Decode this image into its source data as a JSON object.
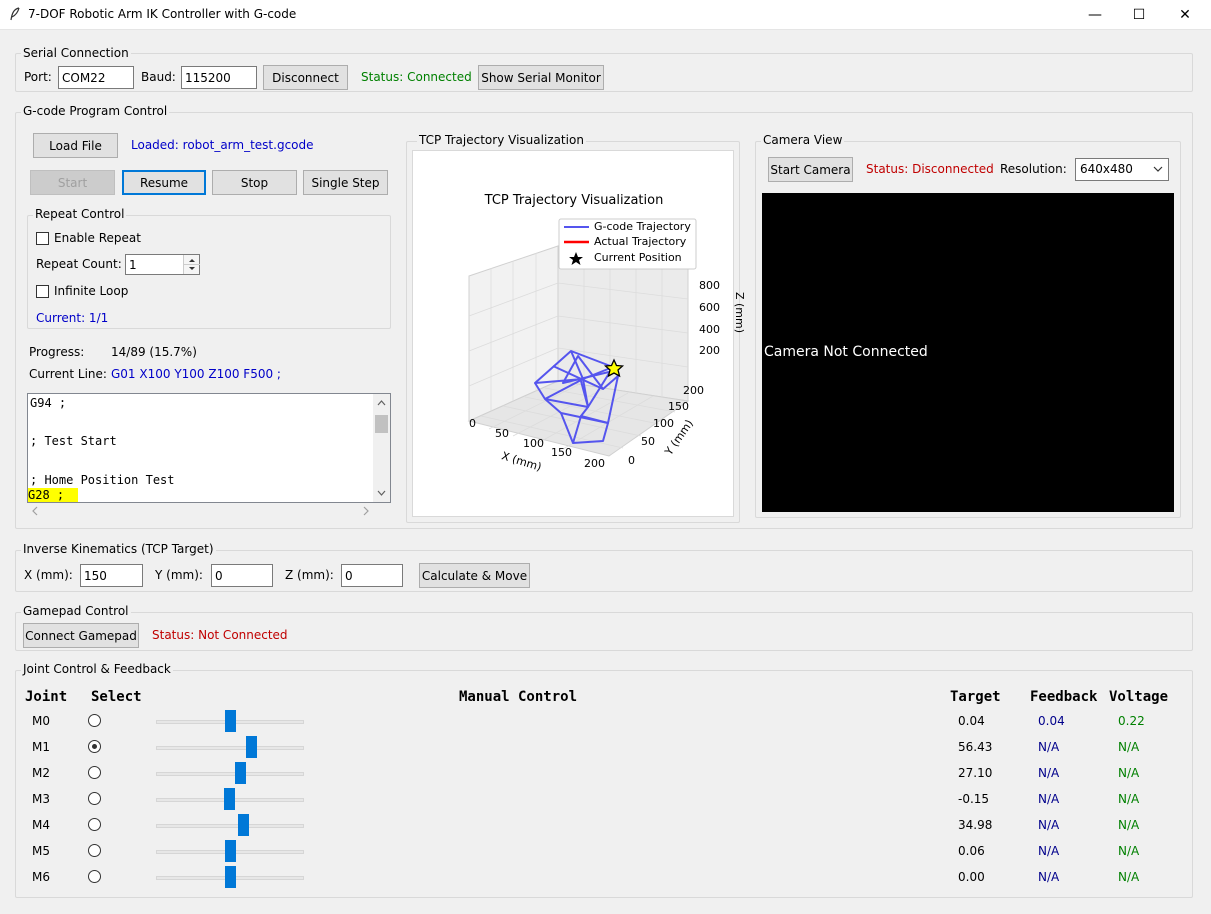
{
  "window": {
    "title": "7-DOF Robotic Arm IK Controller with G-code",
    "minimize": "—",
    "maximize": "☐",
    "close": "✕"
  },
  "serial": {
    "group_label": "Serial Connection",
    "port_label": "Port:",
    "port_value": "COM22",
    "baud_label": "Baud:",
    "baud_value": "115200",
    "disconnect_label": "Disconnect",
    "status": "Status: Connected",
    "monitor_label": "Show Serial Monitor"
  },
  "gcode": {
    "group_label": "G-code Program Control",
    "load_label": "Load File",
    "loaded_text": "Loaded: robot_arm_test.gcode",
    "start_label": "Start",
    "resume_label": "Resume",
    "stop_label": "Stop",
    "step_label": "Single Step",
    "repeat": {
      "group_label": "Repeat Control",
      "enable_label": "Enable Repeat",
      "count_label": "Repeat Count:",
      "count_value": "1",
      "infinite_label": "Infinite Loop",
      "current": "Current: 1/1"
    },
    "progress_label": "Progress:",
    "progress_value": "14/89 (15.7%)",
    "current_line_label": "Current Line:",
    "current_line_value": "G01 X100 Y100 Z100 F500 ;",
    "lines": [
      "G94 ;",
      "",
      "; Test Start",
      "",
      "; Home Position Test",
      "G28 ;"
    ]
  },
  "trajectory": {
    "group_label": "TCP Trajectory Visualization",
    "plot_title": "TCP Trajectory Visualization",
    "legend": [
      "G-code Trajectory",
      "Actual Trajectory",
      "Current Position"
    ],
    "x_label": "X (mm)",
    "y_label": "Y (mm)",
    "z_label": "Z (mm)",
    "x_ticks": [
      "0",
      "50",
      "100",
      "150",
      "200"
    ],
    "y_ticks": [
      "0",
      "50",
      "100",
      "150",
      "200"
    ],
    "z_ticks": [
      "200",
      "400",
      "600",
      "800"
    ],
    "colors": {
      "gcode": "#5555ee",
      "actual": "#ff0000",
      "current": "#ffff00"
    }
  },
  "camera": {
    "group_label": "Camera View",
    "start_label": "Start Camera",
    "status": "Status: Disconnected",
    "resolution_label": "Resolution:",
    "resolution_value": "640x480",
    "placeholder": "Camera Not Connected"
  },
  "ik": {
    "group_label": "Inverse Kinematics (TCP Target)",
    "x_label": "X (mm):",
    "x_value": "150",
    "y_label": "Y (mm):",
    "y_value": "0",
    "z_label": "Z (mm):",
    "z_value": "0",
    "calc_label": "Calculate & Move"
  },
  "gamepad": {
    "group_label": "Gamepad Control",
    "connect_label": "Connect Gamepad",
    "status": "Status: Not Connected"
  },
  "joints": {
    "group_label": "Joint Control & Feedback",
    "headers": {
      "joint": "Joint",
      "select": "Select",
      "manual": "Manual Control",
      "target": "Target",
      "feedback": "Feedback",
      "voltage": "Voltage"
    },
    "rows": [
      {
        "name": "M0",
        "selected": false,
        "slider": 0.5,
        "target": "0.04",
        "feedback": "0.04",
        "voltage": "0.22"
      },
      {
        "name": "M1",
        "selected": true,
        "slider": 0.64,
        "target": "56.43",
        "feedback": "N/A",
        "voltage": "N/A"
      },
      {
        "name": "M2",
        "selected": false,
        "slider": 0.57,
        "target": "27.10",
        "feedback": "N/A",
        "voltage": "N/A"
      },
      {
        "name": "M3",
        "selected": false,
        "slider": 0.49,
        "target": "-0.15",
        "feedback": "N/A",
        "voltage": "N/A"
      },
      {
        "name": "M4",
        "selected": false,
        "slider": 0.59,
        "target": "34.98",
        "feedback": "N/A",
        "voltage": "N/A"
      },
      {
        "name": "M5",
        "selected": false,
        "slider": 0.5,
        "target": "0.06",
        "feedback": "N/A",
        "voltage": "N/A"
      },
      {
        "name": "M6",
        "selected": false,
        "slider": 0.5,
        "target": "0.00",
        "feedback": "N/A",
        "voltage": "N/A"
      }
    ]
  }
}
